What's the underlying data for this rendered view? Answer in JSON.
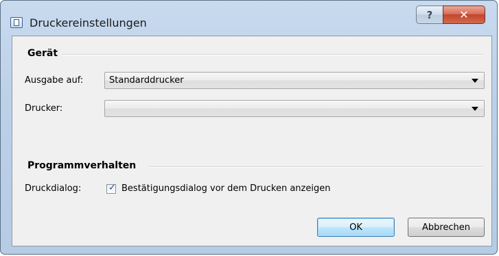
{
  "window": {
    "title": "Druckereinstellungen",
    "help_symbol": "?",
    "close_symbol": "✕"
  },
  "device_group": {
    "heading": "Gerät",
    "output_label": "Ausgabe auf:",
    "output_value": "Standarddrucker",
    "printer_label": "Drucker:",
    "printer_value": ""
  },
  "behavior_group": {
    "heading": "Programmverhalten",
    "dialog_label": "Druckdialog:",
    "confirm_checkbox_label": "Bestätigungsdialog vor dem Drucken anzeigen",
    "confirm_checked": true
  },
  "buttons": {
    "ok": "OK",
    "cancel": "Abbrechen"
  },
  "icons": {
    "app": "printer-settings-icon",
    "help": "help-icon",
    "close": "close-icon",
    "dropdown": "chevron-down-icon",
    "check": "checkmark-icon"
  },
  "colors": {
    "title_bar": "#bcd0e8",
    "close_button": "#c2462c",
    "client_bg": "#f0f0f0",
    "default_button": "#bee6fd"
  }
}
